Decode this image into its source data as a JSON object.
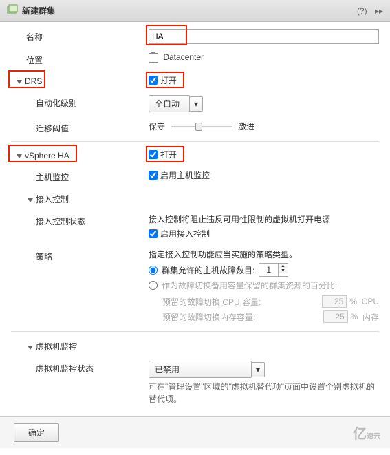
{
  "header": {
    "title": "新建群集"
  },
  "labels": {
    "name": "名称",
    "location": "位置",
    "drs": "DRS",
    "automation_level": "自动化级别",
    "migration_threshold": "迁移阈值",
    "vsphere_ha": "vSphere HA",
    "host_monitoring": "主机监控",
    "admission_control": "接入控制",
    "admission_control_status": "接入控制状态",
    "policy": "策略",
    "vm_monitoring": "虚拟机监控",
    "vm_monitoring_status": "虚拟机监控状态"
  },
  "values": {
    "name": "HA",
    "location": "Datacenter",
    "drs_enable": "打开",
    "automation_level": "全自动",
    "slider_left": "保守",
    "slider_right": "激进",
    "ha_enable": "打开",
    "host_monitoring_enable": "启用主机监控",
    "admission_desc": "接入控制将阻止违反可用性限制的虚拟机打开电源",
    "admission_enable": "启用接入控制",
    "policy_desc": "指定接入控制功能应当实施的策略类型。",
    "policy_radio1": "群集允许的主机故障数目:",
    "policy_radio1_value": "1",
    "policy_radio2": "作为故障切换备用容量保留的群集资源的百分比:",
    "reserved_cpu_label": "预留的故障切换 CPU 容量:",
    "reserved_mem_label": "预留的故障切换内存容量:",
    "pct_value": "25",
    "pct_unit": "%",
    "cpu_unit": "CPU",
    "mem_unit": "内存",
    "vm_monitoring_status": "已禁用",
    "vm_monitoring_desc": "可在\"管理设置\"区域的\"虚拟机替代项\"页面中设置个别虚拟机的替代项。",
    "ok_button": "确定"
  }
}
